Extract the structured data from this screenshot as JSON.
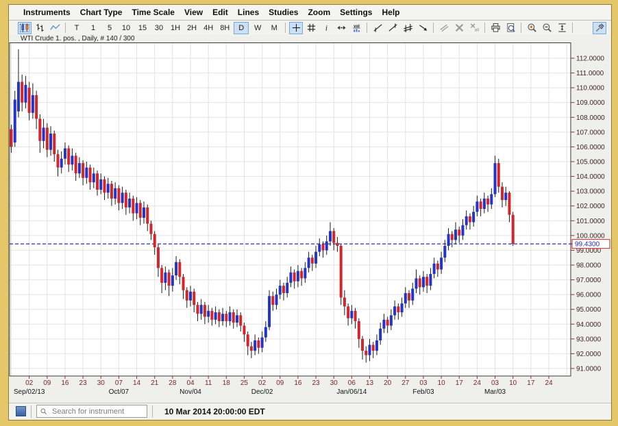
{
  "menu": {
    "items": [
      "Instruments",
      "Chart Type",
      "Time Scale",
      "View",
      "Edit",
      "Lines",
      "Studies",
      "Zoom",
      "Settings",
      "Help"
    ]
  },
  "toolbar": {
    "chart_type_buttons": [
      {
        "icon": "candlestick-chart",
        "selected": true
      },
      {
        "icon": "ohlc-bars-chart",
        "selected": false
      },
      {
        "icon": "line-chart",
        "selected": false
      }
    ],
    "timeframe_buttons": [
      {
        "label": "T"
      },
      {
        "label": "1"
      },
      {
        "label": "5"
      },
      {
        "label": "10"
      },
      {
        "label": "15"
      },
      {
        "label": "30"
      },
      {
        "label": "1H"
      },
      {
        "label": "2H"
      },
      {
        "label": "4H"
      },
      {
        "label": "8H"
      },
      {
        "label": "D",
        "selected": true
      },
      {
        "label": "W"
      },
      {
        "label": "M"
      }
    ],
    "tool_buttons": [
      {
        "icon": "crosshair",
        "selected": true
      },
      {
        "icon": "grid"
      },
      {
        "icon": "info"
      },
      {
        "icon": "horizontal-scroll"
      },
      {
        "icon": "volume"
      }
    ],
    "line_tool_buttons": [
      {
        "icon": "trend-line"
      },
      {
        "icon": "vertical-trend-line"
      },
      {
        "icon": "parallel-lines"
      },
      {
        "icon": "ray-line"
      }
    ],
    "edit_buttons": [
      {
        "icon": "move-parallel",
        "disabled": true
      },
      {
        "icon": "delete-line",
        "disabled": true
      },
      {
        "icon": "delete-all-lines",
        "disabled": true
      }
    ],
    "print_buttons": [
      {
        "icon": "print"
      },
      {
        "icon": "print-preview"
      }
    ],
    "zoom_buttons": [
      {
        "icon": "zoom-in"
      },
      {
        "icon": "zoom-out"
      },
      {
        "icon": "fit-vertical"
      }
    ],
    "pin_button": {
      "icon": "pushpin",
      "selected": true
    }
  },
  "chart": {
    "title": "WTI Crude 1. pos. , Daily, # 140 / 300"
  },
  "colors": {
    "up_candle": "#2433c8",
    "down_candle": "#d2262b",
    "wick": "#1a1a1a",
    "dashed_line": "#2428c8",
    "price_label_text": "#2a2ac8",
    "price_label_border": "#c82a2a",
    "grid": "#e2e2df",
    "plot_border": "#3a3a3a",
    "axis_text": "#402424",
    "tick": "#8b3030",
    "day_label": "#7a2424",
    "month_label": "#141414",
    "plot_bg": "#ffffff"
  },
  "chart_data": {
    "type": "candlestick",
    "instrument": "WTI Crude 1. pos.",
    "interval": "Daily",
    "bar_counter": "# 140 / 300",
    "title": "WTI Crude 1. pos. , Daily, # 140 / 300",
    "ylim": [
      91,
      112
    ],
    "y_tick_labels": [
      "91.0000",
      "92.0000",
      "93.0000",
      "94.0000",
      "95.0000",
      "96.0000",
      "97.0000",
      "98.0000",
      "99.0000",
      "100.0000",
      "101.0000",
      "102.0000",
      "103.0000",
      "104.0000",
      "105.0000",
      "106.0000",
      "107.0000",
      "108.0000",
      "109.0000",
      "110.0000",
      "111.0000",
      "112.0000"
    ],
    "hline_value": 99.43,
    "hline_label": "99.4300",
    "x_day_labels": [
      "02",
      "09",
      "16",
      "23",
      "30",
      "07",
      "14",
      "21",
      "28",
      "04",
      "11",
      "18",
      "25",
      "02",
      "09",
      "16",
      "23",
      "30",
      "06",
      "13",
      "20",
      "27",
      "03",
      "10",
      "17",
      "24",
      "03",
      "10",
      "17",
      "24"
    ],
    "x_day_label_start_slot": 5,
    "x_day_label_step": 5,
    "x_month_labels": [
      {
        "slot": 5,
        "label": "Sep/02/13"
      },
      {
        "slot": 30,
        "label": "Oct/07"
      },
      {
        "slot": 50,
        "label": "Nov/04"
      },
      {
        "slot": 70,
        "label": "Dec/02"
      },
      {
        "slot": 95,
        "label": "Jan/06/14"
      },
      {
        "slot": 115,
        "label": "Feb/03"
      },
      {
        "slot": 135,
        "label": "Mar/03"
      }
    ],
    "ohlc": [
      [
        107.2,
        107.5,
        105.6,
        106.0
      ],
      [
        106.3,
        109.8,
        106.0,
        109.2
      ],
      [
        108.4,
        112.6,
        108.0,
        110.4
      ],
      [
        110.4,
        110.9,
        108.4,
        109.0
      ],
      [
        109.0,
        110.8,
        108.6,
        110.2
      ],
      [
        110.0,
        110.4,
        107.8,
        108.3
      ],
      [
        108.3,
        110.3,
        107.9,
        109.5
      ],
      [
        109.5,
        109.8,
        107.2,
        107.9
      ],
      [
        107.9,
        108.2,
        105.6,
        106.4
      ],
      [
        106.4,
        107.9,
        105.9,
        107.3
      ],
      [
        107.3,
        107.6,
        105.3,
        105.8
      ],
      [
        105.8,
        107.4,
        105.4,
        106.9
      ],
      [
        106.9,
        107.1,
        105.0,
        105.5
      ],
      [
        105.5,
        105.8,
        104.0,
        104.6
      ],
      [
        104.6,
        105.7,
        104.2,
        105.2
      ],
      [
        105.2,
        106.3,
        104.8,
        105.9
      ],
      [
        105.9,
        106.1,
        104.3,
        104.8
      ],
      [
        104.8,
        105.9,
        104.4,
        105.4
      ],
      [
        105.4,
        105.6,
        103.7,
        104.2
      ],
      [
        104.2,
        105.3,
        103.9,
        104.9
      ],
      [
        104.9,
        105.1,
        103.4,
        103.9
      ],
      [
        103.9,
        105.0,
        103.5,
        104.6
      ],
      [
        104.6,
        104.8,
        103.1,
        103.6
      ],
      [
        103.6,
        104.6,
        103.2,
        104.2
      ],
      [
        104.2,
        104.4,
        102.7,
        103.1
      ],
      [
        103.1,
        104.2,
        102.8,
        103.8
      ],
      [
        103.8,
        104.0,
        102.4,
        102.9
      ],
      [
        102.9,
        103.9,
        102.5,
        103.5
      ],
      [
        103.5,
        103.7,
        102.0,
        102.5
      ],
      [
        102.5,
        103.6,
        102.1,
        103.2
      ],
      [
        103.2,
        103.4,
        101.7,
        102.2
      ],
      [
        102.2,
        103.3,
        101.8,
        102.9
      ],
      [
        102.9,
        103.1,
        101.4,
        101.9
      ],
      [
        101.9,
        102.9,
        101.5,
        102.5
      ],
      [
        102.5,
        102.7,
        101.0,
        101.5
      ],
      [
        101.5,
        102.6,
        101.1,
        102.2
      ],
      [
        102.2,
        102.4,
        100.7,
        101.2
      ],
      [
        101.2,
        102.3,
        100.8,
        101.9
      ],
      [
        101.9,
        102.1,
        100.3,
        100.8
      ],
      [
        100.8,
        101.0,
        99.7,
        100.1
      ],
      [
        100.1,
        100.3,
        98.7,
        99.2
      ],
      [
        99.2,
        99.4,
        97.2,
        97.8
      ],
      [
        97.8,
        98.0,
        96.1,
        96.8
      ],
      [
        96.8,
        97.9,
        96.3,
        97.5
      ],
      [
        97.5,
        97.7,
        95.9,
        96.6
      ],
      [
        96.6,
        97.8,
        96.2,
        97.3
      ],
      [
        97.3,
        98.6,
        97.0,
        98.2
      ],
      [
        98.2,
        98.4,
        96.7,
        97.2
      ],
      [
        97.2,
        97.4,
        95.7,
        96.3
      ],
      [
        96.3,
        96.5,
        95.1,
        95.6
      ],
      [
        95.6,
        96.6,
        95.2,
        96.2
      ],
      [
        96.2,
        96.4,
        94.8,
        95.3
      ],
      [
        95.3,
        95.5,
        94.2,
        94.7
      ],
      [
        94.7,
        95.7,
        94.3,
        95.3
      ],
      [
        95.3,
        95.5,
        94.0,
        94.5
      ],
      [
        94.5,
        95.3,
        94.1,
        94.9
      ],
      [
        94.9,
        95.1,
        93.9,
        94.3
      ],
      [
        94.3,
        95.2,
        94.0,
        94.8
      ],
      [
        94.8,
        95.0,
        93.8,
        94.2
      ],
      [
        94.2,
        95.1,
        93.9,
        94.7
      ],
      [
        94.7,
        94.9,
        93.8,
        94.2
      ],
      [
        94.2,
        95.2,
        93.9,
        94.8
      ],
      [
        94.8,
        95.0,
        93.7,
        94.1
      ],
      [
        94.1,
        95.0,
        93.8,
        94.6
      ],
      [
        94.6,
        94.8,
        93.5,
        93.9
      ],
      [
        93.9,
        94.1,
        92.8,
        93.3
      ],
      [
        93.3,
        93.5,
        91.9,
        92.5
      ],
      [
        92.5,
        92.8,
        91.7,
        92.2
      ],
      [
        92.2,
        93.3,
        91.9,
        92.9
      ],
      [
        92.9,
        93.1,
        92.0,
        92.4
      ],
      [
        92.4,
        93.5,
        92.1,
        93.1
      ],
      [
        93.1,
        94.2,
        92.8,
        93.8
      ],
      [
        93.8,
        96.3,
        93.6,
        95.9
      ],
      [
        95.9,
        96.2,
        94.9,
        95.3
      ],
      [
        95.3,
        96.4,
        95.0,
        96.0
      ],
      [
        96.0,
        97.0,
        95.7,
        96.6
      ],
      [
        96.6,
        96.8,
        95.6,
        96.1
      ],
      [
        96.1,
        97.2,
        95.8,
        96.8
      ],
      [
        96.8,
        97.9,
        96.5,
        97.5
      ],
      [
        97.5,
        97.7,
        96.4,
        96.9
      ],
      [
        96.9,
        98.0,
        96.5,
        97.6
      ],
      [
        97.6,
        97.8,
        96.6,
        97.1
      ],
      [
        97.1,
        98.2,
        96.8,
        97.8
      ],
      [
        97.8,
        98.9,
        97.5,
        98.5
      ],
      [
        98.5,
        98.7,
        97.6,
        98.1
      ],
      [
        98.1,
        99.3,
        97.8,
        98.9
      ],
      [
        98.9,
        99.8,
        98.6,
        99.4
      ],
      [
        99.4,
        99.6,
        98.5,
        99.0
      ],
      [
        99.0,
        100.0,
        98.7,
        99.6
      ],
      [
        99.6,
        100.9,
        99.3,
        100.3
      ],
      [
        100.3,
        100.5,
        99.0,
        99.5
      ],
      [
        99.5,
        99.9,
        98.9,
        99.3
      ],
      [
        99.3,
        99.4,
        95.3,
        95.8
      ],
      [
        95.8,
        96.3,
        94.6,
        95.2
      ],
      [
        95.2,
        95.4,
        93.9,
        94.4
      ],
      [
        94.4,
        95.3,
        94.0,
        94.9
      ],
      [
        94.9,
        95.1,
        93.7,
        94.2
      ],
      [
        94.2,
        94.4,
        92.4,
        93.0
      ],
      [
        93.0,
        93.2,
        91.6,
        92.2
      ],
      [
        92.2,
        92.5,
        91.4,
        91.9
      ],
      [
        91.9,
        93.0,
        91.5,
        92.6
      ],
      [
        92.6,
        92.8,
        91.7,
        92.2
      ],
      [
        92.2,
        93.3,
        91.9,
        92.9
      ],
      [
        92.9,
        94.1,
        92.6,
        93.7
      ],
      [
        93.7,
        94.7,
        93.4,
        94.3
      ],
      [
        94.3,
        94.5,
        93.4,
        93.9
      ],
      [
        93.9,
        95.0,
        93.6,
        94.6
      ],
      [
        94.6,
        95.6,
        94.3,
        95.2
      ],
      [
        95.2,
        95.4,
        94.3,
        94.8
      ],
      [
        94.8,
        95.8,
        94.5,
        95.4
      ],
      [
        95.4,
        96.5,
        95.1,
        96.1
      ],
      [
        96.1,
        96.3,
        95.1,
        95.6
      ],
      [
        95.6,
        96.8,
        95.3,
        96.4
      ],
      [
        96.4,
        97.7,
        96.1,
        97.1
      ],
      [
        97.1,
        97.3,
        96.0,
        96.5
      ],
      [
        96.5,
        97.6,
        96.2,
        97.2
      ],
      [
        97.2,
        97.4,
        96.1,
        96.6
      ],
      [
        96.6,
        97.8,
        96.3,
        97.4
      ],
      [
        97.4,
        98.5,
        97.1,
        98.1
      ],
      [
        98.1,
        98.3,
        97.2,
        97.7
      ],
      [
        97.7,
        98.9,
        97.4,
        98.5
      ],
      [
        98.5,
        99.7,
        98.2,
        99.3
      ],
      [
        99.3,
        100.5,
        99.0,
        100.1
      ],
      [
        100.1,
        100.3,
        99.2,
        99.7
      ],
      [
        99.7,
        100.9,
        99.4,
        100.4
      ],
      [
        100.4,
        100.6,
        99.5,
        100.0
      ],
      [
        100.0,
        101.1,
        99.7,
        100.7
      ],
      [
        100.7,
        101.7,
        100.4,
        101.3
      ],
      [
        101.3,
        101.5,
        100.4,
        100.9
      ],
      [
        100.9,
        102.0,
        100.6,
        101.6
      ],
      [
        101.6,
        102.7,
        101.3,
        102.3
      ],
      [
        102.3,
        102.5,
        101.3,
        101.8
      ],
      [
        101.8,
        102.9,
        101.5,
        102.5
      ],
      [
        102.5,
        102.7,
        101.6,
        102.1
      ],
      [
        102.1,
        103.2,
        101.8,
        102.8
      ],
      [
        102.8,
        105.4,
        102.6,
        104.9
      ],
      [
        104.9,
        105.2,
        102.9,
        103.3
      ],
      [
        103.3,
        103.6,
        101.9,
        102.4
      ],
      [
        102.4,
        103.3,
        102.0,
        102.9
      ],
      [
        102.9,
        103.0,
        100.9,
        101.4
      ],
      [
        101.4,
        101.6,
        99.3,
        99.43
      ]
    ]
  },
  "statusbar": {
    "search_placeholder": "Search for instrument",
    "timestamp": "10 Mar 2014 20:00:00 EDT"
  }
}
